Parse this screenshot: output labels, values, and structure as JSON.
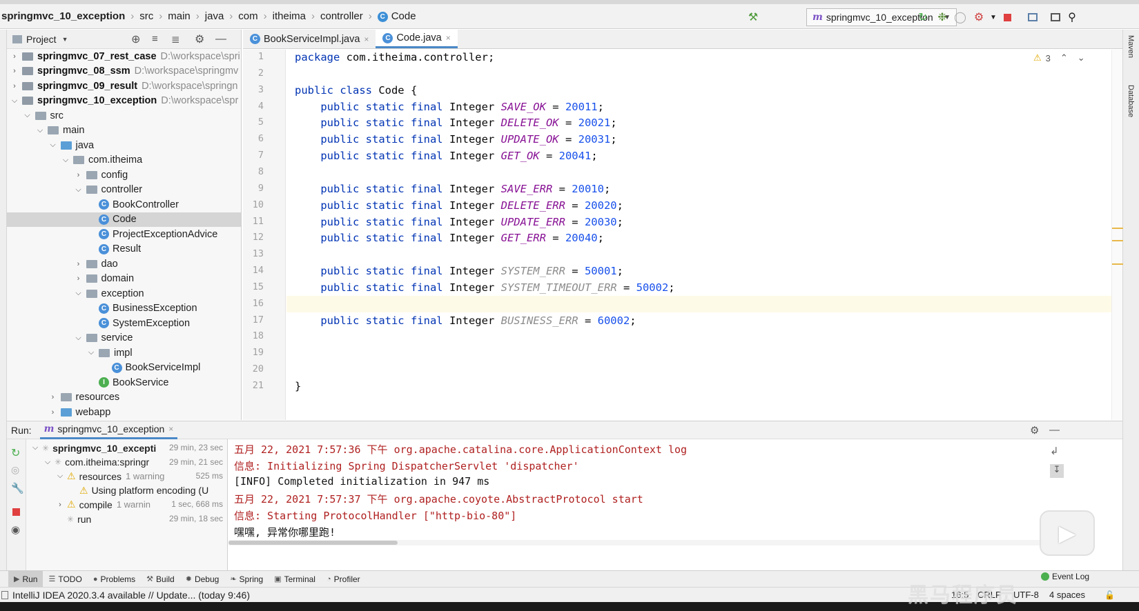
{
  "breadcrumb": [
    "springmvc_10_exception",
    "src",
    "main",
    "java",
    "com",
    "itheima",
    "controller",
    "Code"
  ],
  "run_config": {
    "label": "springmvc_10_exception"
  },
  "left_strip": {
    "project_label": "Project"
  },
  "right_strip": {
    "maven": "Maven",
    "database": "Database"
  },
  "project_panel": {
    "title": "Project",
    "tree": [
      {
        "indent": 0,
        "arrow": "›",
        "type": "proj",
        "name": "springmvc_07_rest_case",
        "path": "D:\\workspace\\spri"
      },
      {
        "indent": 0,
        "arrow": "›",
        "type": "proj",
        "name": "springmvc_08_ssm",
        "path": "D:\\workspace\\springmv"
      },
      {
        "indent": 0,
        "arrow": "›",
        "type": "proj",
        "name": "springmvc_09_result",
        "path": "D:\\workspace\\springn"
      },
      {
        "indent": 0,
        "arrow": "⌄",
        "type": "proj",
        "name": "springmvc_10_exception",
        "path": "D:\\workspace\\spr"
      },
      {
        "indent": 1,
        "arrow": "⌄",
        "type": "folder",
        "name": "src"
      },
      {
        "indent": 2,
        "arrow": "⌄",
        "type": "folder",
        "name": "main"
      },
      {
        "indent": 3,
        "arrow": "⌄",
        "type": "folder-blue",
        "name": "java"
      },
      {
        "indent": 4,
        "arrow": "⌄",
        "type": "folder",
        "name": "com.itheima"
      },
      {
        "indent": 5,
        "arrow": "›",
        "type": "folder",
        "name": "config"
      },
      {
        "indent": 5,
        "arrow": "⌄",
        "type": "folder",
        "name": "controller"
      },
      {
        "indent": 6,
        "arrow": "",
        "type": "class",
        "name": "BookController"
      },
      {
        "indent": 6,
        "arrow": "",
        "type": "class",
        "name": "Code",
        "selected": true
      },
      {
        "indent": 6,
        "arrow": "",
        "type": "class",
        "name": "ProjectExceptionAdvice"
      },
      {
        "indent": 6,
        "arrow": "",
        "type": "class",
        "name": "Result"
      },
      {
        "indent": 5,
        "arrow": "›",
        "type": "folder",
        "name": "dao"
      },
      {
        "indent": 5,
        "arrow": "›",
        "type": "folder",
        "name": "domain"
      },
      {
        "indent": 5,
        "arrow": "⌄",
        "type": "folder",
        "name": "exception"
      },
      {
        "indent": 6,
        "arrow": "",
        "type": "class",
        "name": "BusinessException"
      },
      {
        "indent": 6,
        "arrow": "",
        "type": "class-exc",
        "name": "SystemException"
      },
      {
        "indent": 5,
        "arrow": "⌄",
        "type": "folder",
        "name": "service"
      },
      {
        "indent": 6,
        "arrow": "⌄",
        "type": "folder",
        "name": "impl"
      },
      {
        "indent": 7,
        "arrow": "",
        "type": "class",
        "name": "BookServiceImpl"
      },
      {
        "indent": 6,
        "arrow": "",
        "type": "interface",
        "name": "BookService"
      },
      {
        "indent": 3,
        "arrow": "›",
        "type": "folder",
        "name": "resources"
      },
      {
        "indent": 3,
        "arrow": "›",
        "type": "folder-blue",
        "name": "webapp"
      }
    ]
  },
  "editor": {
    "tabs": [
      {
        "label": "BookServiceImpl.java",
        "active": false
      },
      {
        "label": "Code.java",
        "active": true
      }
    ],
    "warnings_count": "3",
    "line_numbers": [
      "1",
      "2",
      "3",
      "4",
      "5",
      "6",
      "7",
      "8",
      "9",
      "10",
      "11",
      "12",
      "13",
      "14",
      "15",
      "16",
      "17",
      "18",
      "19",
      "20",
      "21"
    ],
    "lines": [
      [
        [
          "kw",
          "package"
        ],
        [
          "p",
          " com.itheima.controller;"
        ]
      ],
      [],
      [
        [
          "kw",
          "public class"
        ],
        [
          "p",
          " Code {"
        ]
      ],
      [
        [
          "p",
          "    "
        ],
        [
          "kw",
          "public static final"
        ],
        [
          "p",
          " Integer "
        ],
        [
          "fld",
          "SAVE_OK"
        ],
        [
          "p",
          " = "
        ],
        [
          "num",
          "20011"
        ],
        [
          "p",
          ";"
        ]
      ],
      [
        [
          "p",
          "    "
        ],
        [
          "kw",
          "public static final"
        ],
        [
          "p",
          " Integer "
        ],
        [
          "fld",
          "DELETE_OK"
        ],
        [
          "p",
          " = "
        ],
        [
          "num",
          "20021"
        ],
        [
          "p",
          ";"
        ]
      ],
      [
        [
          "p",
          "    "
        ],
        [
          "kw",
          "public static final"
        ],
        [
          "p",
          " Integer "
        ],
        [
          "fld",
          "UPDATE_OK"
        ],
        [
          "p",
          " = "
        ],
        [
          "num",
          "20031"
        ],
        [
          "p",
          ";"
        ]
      ],
      [
        [
          "p",
          "    "
        ],
        [
          "kw",
          "public static final"
        ],
        [
          "p",
          " Integer "
        ],
        [
          "fld",
          "GET_OK"
        ],
        [
          "p",
          " = "
        ],
        [
          "num",
          "20041"
        ],
        [
          "p",
          ";"
        ]
      ],
      [],
      [
        [
          "p",
          "    "
        ],
        [
          "kw",
          "public static final"
        ],
        [
          "p",
          " Integer "
        ],
        [
          "fld",
          "SAVE_ERR"
        ],
        [
          "p",
          " = "
        ],
        [
          "num",
          "20010"
        ],
        [
          "p",
          ";"
        ]
      ],
      [
        [
          "p",
          "    "
        ],
        [
          "kw",
          "public static final"
        ],
        [
          "p",
          " Integer "
        ],
        [
          "fld",
          "DELETE_ERR"
        ],
        [
          "p",
          " = "
        ],
        [
          "num",
          "20020"
        ],
        [
          "p",
          ";"
        ]
      ],
      [
        [
          "p",
          "    "
        ],
        [
          "kw",
          "public static final"
        ],
        [
          "p",
          " Integer "
        ],
        [
          "fld",
          "UPDATE_ERR"
        ],
        [
          "p",
          " = "
        ],
        [
          "num",
          "20030"
        ],
        [
          "p",
          ";"
        ]
      ],
      [
        [
          "p",
          "    "
        ],
        [
          "kw",
          "public static final"
        ],
        [
          "p",
          " Integer "
        ],
        [
          "fld",
          "GET_ERR"
        ],
        [
          "p",
          " = "
        ],
        [
          "num",
          "20040"
        ],
        [
          "p",
          ";"
        ]
      ],
      [],
      [
        [
          "p",
          "    "
        ],
        [
          "kw",
          "public static final"
        ],
        [
          "p",
          " Integer "
        ],
        [
          "fldg",
          "SYSTEM_ERR"
        ],
        [
          "p",
          " = "
        ],
        [
          "num",
          "50001"
        ],
        [
          "p",
          ";"
        ]
      ],
      [
        [
          "p",
          "    "
        ],
        [
          "kw",
          "public static final"
        ],
        [
          "p",
          " Integer "
        ],
        [
          "fldg",
          "SYSTEM_TIMEOUT_ERR"
        ],
        [
          "p",
          " = "
        ],
        [
          "num",
          "50002"
        ],
        [
          "p",
          ";"
        ]
      ],
      [],
      [
        [
          "p",
          "    "
        ],
        [
          "kw",
          "public static final"
        ],
        [
          "p",
          " Integer "
        ],
        [
          "fldg",
          "BUSINESS_ERR"
        ],
        [
          "p",
          " = "
        ],
        [
          "num",
          "60002"
        ],
        [
          "p",
          ";"
        ]
      ],
      [],
      [],
      [],
      [
        [
          "p",
          "}"
        ]
      ]
    ],
    "current_line": 16
  },
  "run_panel": {
    "label": "Run:",
    "config_tab": "springmvc_10_exception",
    "tree": [
      {
        "indent": 0,
        "arrow": "⌄",
        "icon": "spinner",
        "text": "springmvc_10_excepti",
        "bold": true,
        "time": "29 min, 23 sec"
      },
      {
        "indent": 1,
        "arrow": "⌄",
        "icon": "spinner",
        "text": "com.itheima:springr",
        "bold": false,
        "time": "29 min, 21 sec"
      },
      {
        "indent": 2,
        "arrow": "⌄",
        "icon": "warning",
        "text": "resources",
        "extra": "1 warning",
        "bold": false,
        "time": "525 ms"
      },
      {
        "indent": 3,
        "arrow": "",
        "icon": "warning",
        "text": "Using platform encoding (U",
        "bold": false,
        "time": ""
      },
      {
        "indent": 2,
        "arrow": "›",
        "icon": "warning",
        "text": "compile",
        "extra": "1 warnin",
        "bold": false,
        "time": "1 sec, 668 ms"
      },
      {
        "indent": 2,
        "arrow": "",
        "icon": "spinner",
        "text": "run",
        "bold": false,
        "time": "29 min, 18 sec"
      }
    ],
    "console": [
      {
        "color": "red",
        "text": "五月 22, 2021 7:57:36 下午 org.apache.catalina.core.ApplicationContext log"
      },
      {
        "color": "red",
        "text": "信息: Initializing Spring DispatcherServlet 'dispatcher'"
      },
      {
        "color": "blk",
        "text": "[INFO] Completed initialization in 947 ms"
      },
      {
        "color": "red",
        "text": "五月 22, 2021 7:57:37 下午 org.apache.coyote.AbstractProtocol start"
      },
      {
        "color": "red",
        "text": "信息: Starting ProtocolHandler [\"http-bio-80\"]"
      },
      {
        "color": "blk",
        "text": "嘿嘿, 异常你哪里跑!"
      }
    ]
  },
  "tool_windows": [
    "Run",
    "TODO",
    "Problems",
    "Build",
    "Debug",
    "Spring",
    "Terminal",
    "Profiler"
  ],
  "event_log": "Event Log",
  "status": {
    "message": "IntelliJ IDEA 2020.3.4 available // Update... (today 9:46)",
    "position": "16:5",
    "line_sep": "CRLF",
    "encoding": "UTF-8",
    "indent": "4 spaces"
  },
  "watermark": "黑马程序员",
  "colors": {
    "accent": "#4a88c7",
    "keyword": "#0033b3",
    "field": "#871094",
    "number": "#1750eb",
    "console_red": "#b02020"
  }
}
